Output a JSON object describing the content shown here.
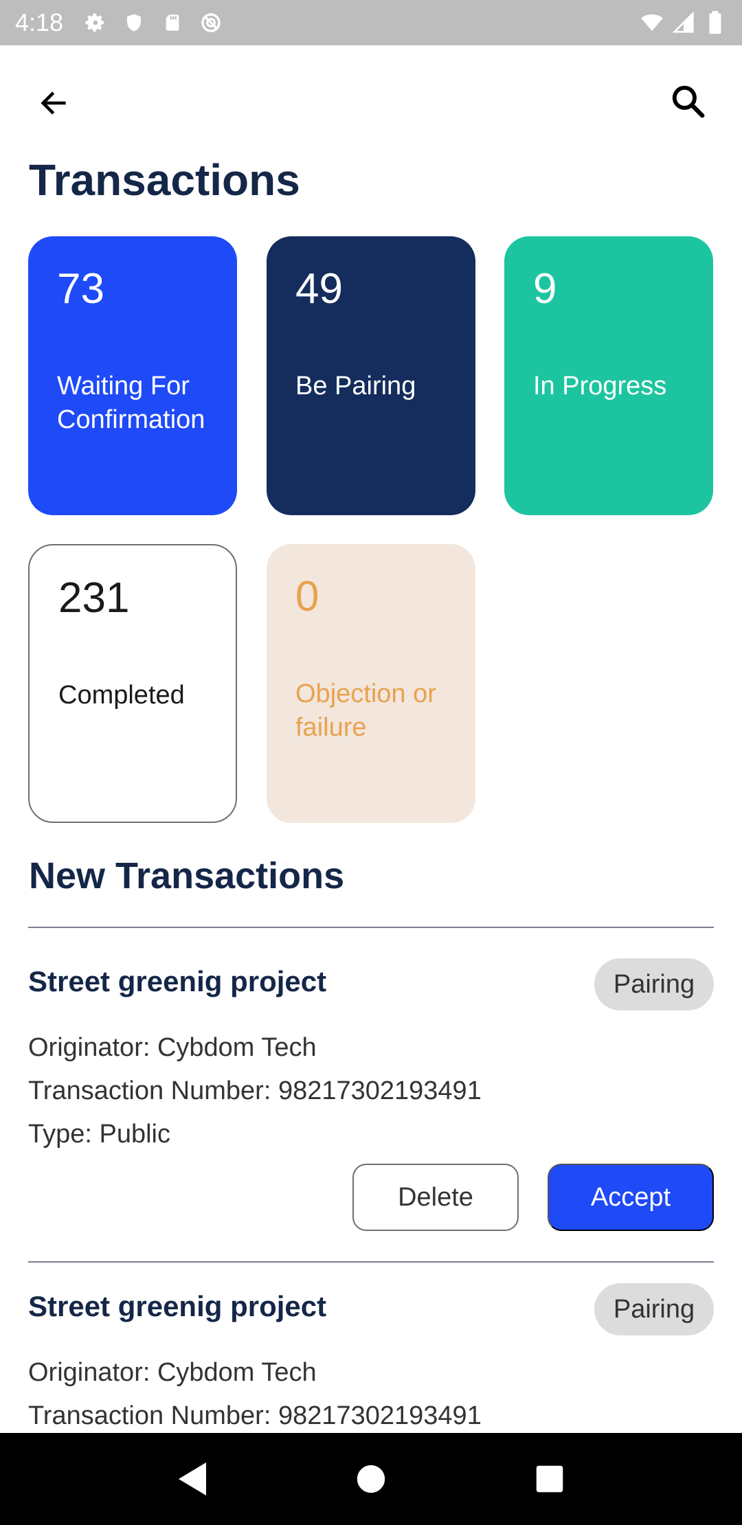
{
  "status_bar": {
    "time": "4:18",
    "icons_left": [
      "gear-icon",
      "shield-icon",
      "sd-card-icon",
      "sync-icon"
    ],
    "icons_right": [
      "wifi-icon",
      "signal-icon",
      "battery-icon"
    ]
  },
  "app_bar": {
    "back_icon": "arrow-left-icon",
    "search_icon": "search-icon"
  },
  "page": {
    "title": "Transactions"
  },
  "stats": [
    {
      "count": "73",
      "label": "Waiting For Confirmation",
      "color": "#1f4af8"
    },
    {
      "count": "49",
      "label": "Be Pairing",
      "color": "#142d5c"
    },
    {
      "count": "9",
      "label": "In Progress",
      "color": "#1cc59f"
    },
    {
      "count": "231",
      "label": "Completed",
      "color": "#ffffff"
    },
    {
      "count": "0",
      "label": "Objection or failure",
      "color": "#f3e6dc"
    }
  ],
  "new_transactions": {
    "title": "New Transactions",
    "items": [
      {
        "title": "Street greenig project",
        "status": "Pairing",
        "originator": "Originator: Cybdom Tech",
        "number": "Transaction Number: 98217302193491",
        "type": "Type: Public",
        "delete_label": "Delete",
        "accept_label": "Accept"
      },
      {
        "title": "Street greenig project",
        "status": "Pairing",
        "originator": "Originator: Cybdom Tech",
        "number": "Transaction Number: 98217302193491"
      }
    ]
  },
  "colors": {
    "primary": "#1f4af8",
    "navy": "#142d5c",
    "teal": "#1cc59f",
    "peach": "#f3e6dc",
    "orange_text": "#e8a24e"
  },
  "nav_bar": {
    "icons": [
      "nav-back-icon",
      "nav-home-icon",
      "nav-recents-icon"
    ]
  }
}
